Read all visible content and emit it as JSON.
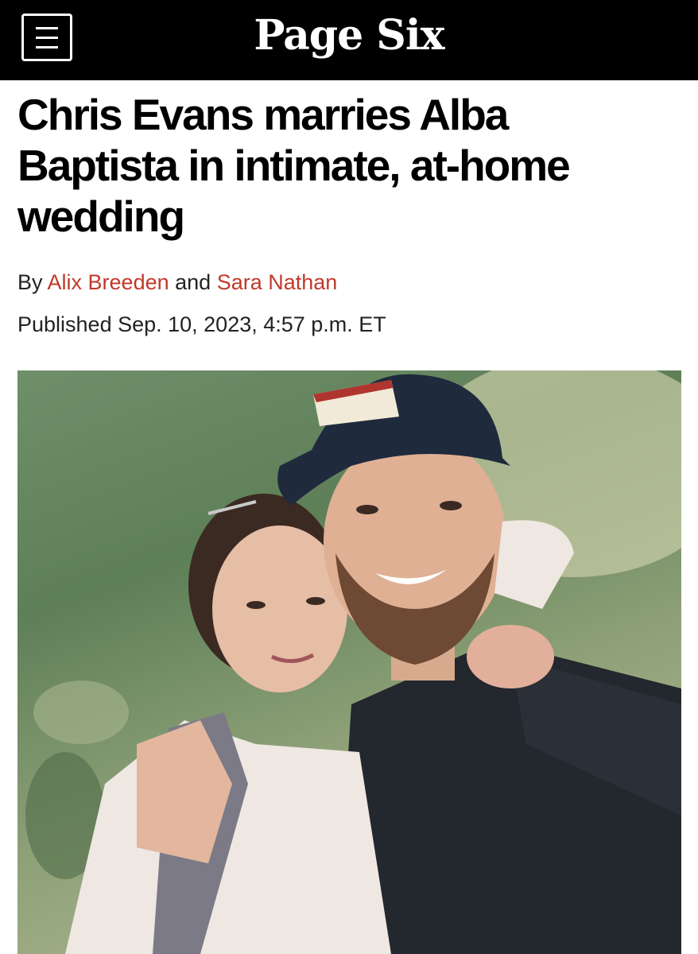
{
  "header": {
    "logo_text": "Page Six",
    "menu_icon": "hamburger-menu-icon"
  },
  "article": {
    "headline": "Chris Evans marries Alba Baptista in intimate, at-home wedding",
    "byline_prefix": "By",
    "author_1": "Alix Breeden",
    "byline_joiner": "and",
    "author_2": "Sara Nathan",
    "published": "Published Sep. 10, 2023, 4:57 p.m. ET"
  },
  "colors": {
    "topbar": "#000000",
    "author_link": "#c0392b"
  }
}
